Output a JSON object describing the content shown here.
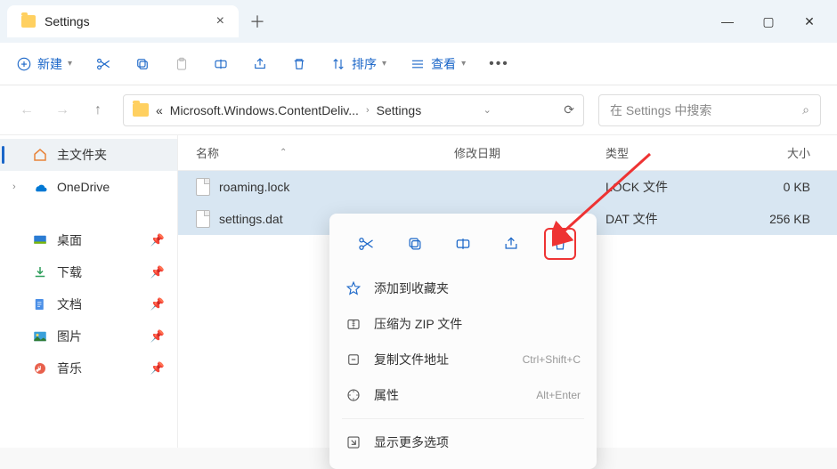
{
  "titlebar": {
    "tab_title": "Settings"
  },
  "toolbar": {
    "new_label": "新建",
    "sort_label": "排序",
    "view_label": "查看"
  },
  "address": {
    "crumb_prefix": "«",
    "crumb1": "Microsoft.Windows.ContentDeliv...",
    "crumb2": "Settings",
    "search_placeholder": "在 Settings 中搜索"
  },
  "sidebar": {
    "home": "主文件夹",
    "onedrive": "OneDrive",
    "desktop": "桌面",
    "downloads": "下载",
    "documents": "文档",
    "pictures": "图片",
    "music": "音乐"
  },
  "columns": {
    "name": "名称",
    "date": "修改日期",
    "type": "类型",
    "size": "大小"
  },
  "files": [
    {
      "name": "roaming.lock",
      "type": "LOCK 文件",
      "size": "0 KB"
    },
    {
      "name": "settings.dat",
      "type": "DAT 文件",
      "size": "256 KB"
    }
  ],
  "context": {
    "favorite": "添加到收藏夹",
    "zip": "压缩为 ZIP 文件",
    "copy_path": "复制文件地址",
    "copy_path_hint": "Ctrl+Shift+C",
    "properties": "属性",
    "properties_hint": "Alt+Enter",
    "more": "显示更多选项"
  }
}
